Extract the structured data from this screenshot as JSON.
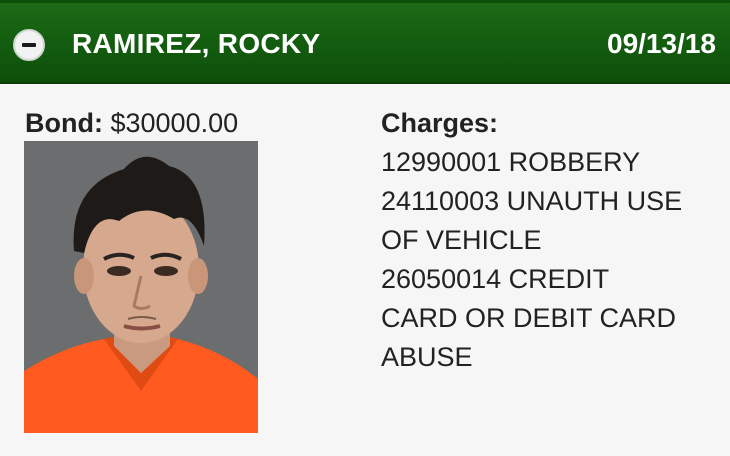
{
  "header": {
    "name": "RAMIREZ, ROCKY",
    "date": "09/13/18"
  },
  "bond": {
    "label": "Bond:",
    "value": "$30000.00"
  },
  "photo": {
    "subject": "booking-photo"
  },
  "charges": {
    "label": "Charges:",
    "lines": [
      "12990001 ROBBERY",
      "24110003 UNAUTH USE",
      "OF VEHICLE",
      "26050014 CREDIT",
      "CARD OR DEBIT CARD",
      "ABUSE"
    ]
  },
  "colors": {
    "header_green": "#125a0e",
    "background": "#f6f6f6"
  }
}
